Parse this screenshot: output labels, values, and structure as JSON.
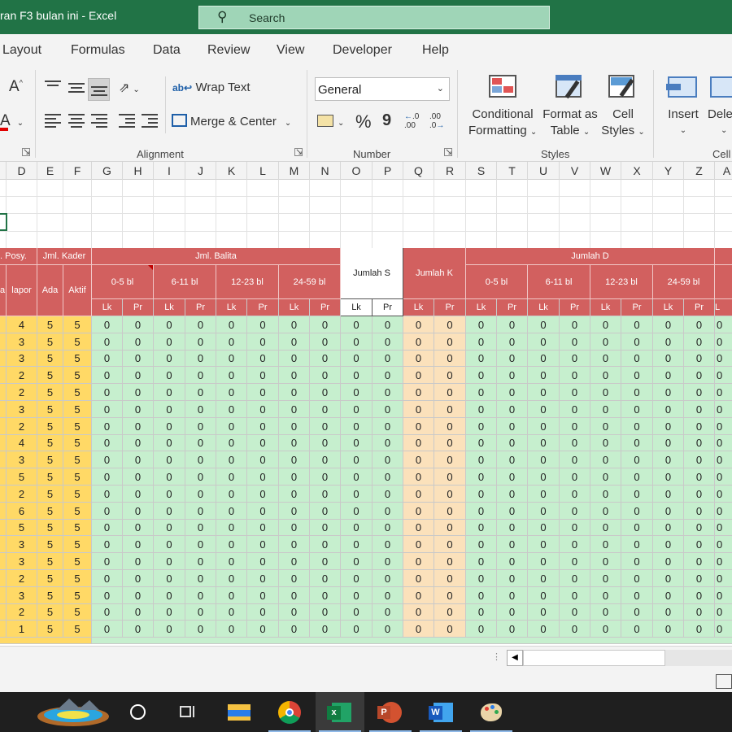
{
  "window": {
    "title": "ran F3 bulan ini  -  Excel",
    "search_placeholder": "Search"
  },
  "ribbon_tabs": [
    "Layout",
    "Formulas",
    "Data",
    "Review",
    "View",
    "Developer",
    "Help"
  ],
  "ribbon": {
    "wrap_text": "Wrap Text",
    "merge_center": "Merge & Center",
    "number_format": "General",
    "conditional_formatting": [
      "Conditional",
      "Formatting"
    ],
    "format_as_table": [
      "Format as",
      "Table"
    ],
    "cell_styles": [
      "Cell",
      "Styles"
    ],
    "insert": "Insert",
    "delete": "Dele",
    "groups": {
      "alignment": "Alignment",
      "number": "Number",
      "styles": "Styles",
      "cells": "Cell"
    },
    "font_size_glyph": "A",
    "percent_glyph": "%",
    "comma_glyph": "9",
    "dec_inc": ".0\n.00",
    "dec_dec": ".00\n.0"
  },
  "columns": [
    "D",
    "E",
    "F",
    "G",
    "H",
    "I",
    "J",
    "K",
    "L",
    "M",
    "N",
    "O",
    "P",
    "Q",
    "R",
    "S",
    "T",
    "U",
    "V",
    "W",
    "X",
    "Y",
    "Z",
    "A"
  ],
  "table_header": {
    "posy": ". Posy.",
    "kader": "Jml. Kader",
    "balita": "Jml. Balita",
    "jumlah_s": "Jumlah S",
    "jumlah_k": "Jumlah K",
    "jumlah_d": "Jumlah D",
    "age_groups": [
      "0-5 bl",
      "6-11 bl",
      "12-23 bl",
      "24-59 bl"
    ],
    "a_label": "a",
    "lapor": "lapor",
    "ada": "Ada",
    "aktif": "Aktif",
    "lk": "Lk",
    "pr": "Pr",
    "partial_l": "L"
  },
  "rows": {
    "lapor": [
      "4",
      "3",
      "3",
      "2",
      "2",
      "3",
      "2",
      "4",
      "3",
      "5",
      "2",
      "6",
      "5",
      "3",
      "3",
      "2",
      "3",
      "2",
      "1"
    ],
    "ada": "5",
    "aktif": "5",
    "value": "0"
  },
  "taskbar": {
    "apps": [
      "cortana-icon",
      "task-view-icon",
      "file-explorer-icon",
      "chrome-icon",
      "excel-icon",
      "powerpoint-icon",
      "word-icon",
      "paint-icon"
    ]
  }
}
